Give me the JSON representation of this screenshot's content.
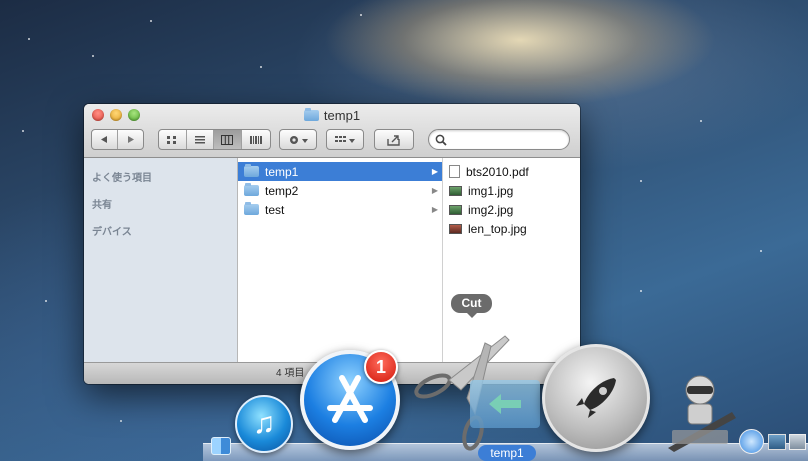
{
  "window": {
    "title": "temp1",
    "search": {
      "placeholder": "",
      "value": ""
    },
    "status": "4 項目"
  },
  "sidebar": {
    "headers": [
      "よく使う項目",
      "共有",
      "デバイス"
    ]
  },
  "columns": {
    "col1": [
      {
        "name": "temp1",
        "selected": true,
        "has_children": true
      },
      {
        "name": "temp2",
        "selected": false,
        "has_children": true
      },
      {
        "name": "test",
        "selected": false,
        "has_children": true
      }
    ],
    "col2": [
      {
        "name": "bts2010.pdf",
        "icon": "pdf-icon"
      },
      {
        "name": "img1.jpg",
        "icon": "image-icon"
      },
      {
        "name": "img2.jpg",
        "icon": "image-icon"
      },
      {
        "name": "len_top.jpg",
        "icon": "image-icon"
      }
    ]
  },
  "dock": {
    "tooltip": "Cut",
    "appstore_badge": "1",
    "drag_label": "temp1",
    "icons": [
      "finder-icon",
      "itunes-icon",
      "app-store-icon",
      "scissors-icon",
      "folder-icon",
      "launchpad-icon",
      "automator-icon",
      "safari-icon",
      "preview-icon",
      "system-preferences-icon"
    ]
  },
  "colors": {
    "selection": "#3c7ed6",
    "badge": "#d2180b",
    "sidebar_bg": "#dde4ec"
  }
}
